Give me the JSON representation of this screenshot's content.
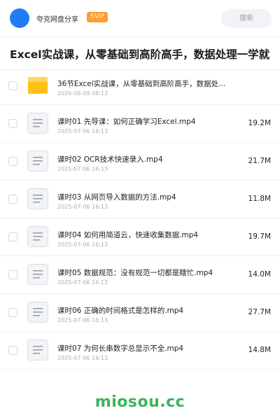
{
  "header": {
    "owner_name": "夸克网盘分享",
    "badge": "SVIP",
    "search_label": "搜索",
    "avatar_color": "#1f7cf6",
    "badge_color": "#ff9d2a"
  },
  "share_title": "Excel实战课，从零基础到高阶高手，数据处理一学就会",
  "share_title_ghost": "一学就会",
  "files": [
    {
      "name": "36节Excel实战课，从零基础到高阶高手，数据处...",
      "date": "2026-06-09 08:13",
      "size": "",
      "icon": "folder-icon"
    },
    {
      "name": "课时01 先导课：如何正确学习Excel.mp4",
      "date": "2025-07-06 16:13",
      "size": "19.2M",
      "icon": "file-icon"
    },
    {
      "name": "课时02 OCR技术快速录入.mp4",
      "date": "2025-07-06 16:13",
      "size": "21.7M",
      "icon": "file-icon"
    },
    {
      "name": "课时03 从网页导入数据的方法.mp4",
      "date": "2025-07-06 16:13",
      "size": "11.8M",
      "icon": "file-icon"
    },
    {
      "name": "课时04 如何用简道云，快速收集数据.mp4",
      "date": "2025-07-06 16:13",
      "size": "19.7M",
      "icon": "file-icon"
    },
    {
      "name": "课时05 数据规范：没有规范一切都是瞎忙.mp4",
      "date": "2025-07-06 16:13",
      "size": "14.0M",
      "icon": "file-icon"
    },
    {
      "name": "课时06 正确的时间格式是怎样的.mp4",
      "date": "2025-07-06 16:13",
      "size": "27.7M",
      "icon": "file-icon"
    },
    {
      "name": "课时07 为何长串数字总显示不全.mp4",
      "date": "2025-07-06 16:13",
      "size": "14.8M",
      "icon": "file-icon"
    }
  ],
  "watermark": "miosou.cc",
  "watermark_color": "#3db35a"
}
